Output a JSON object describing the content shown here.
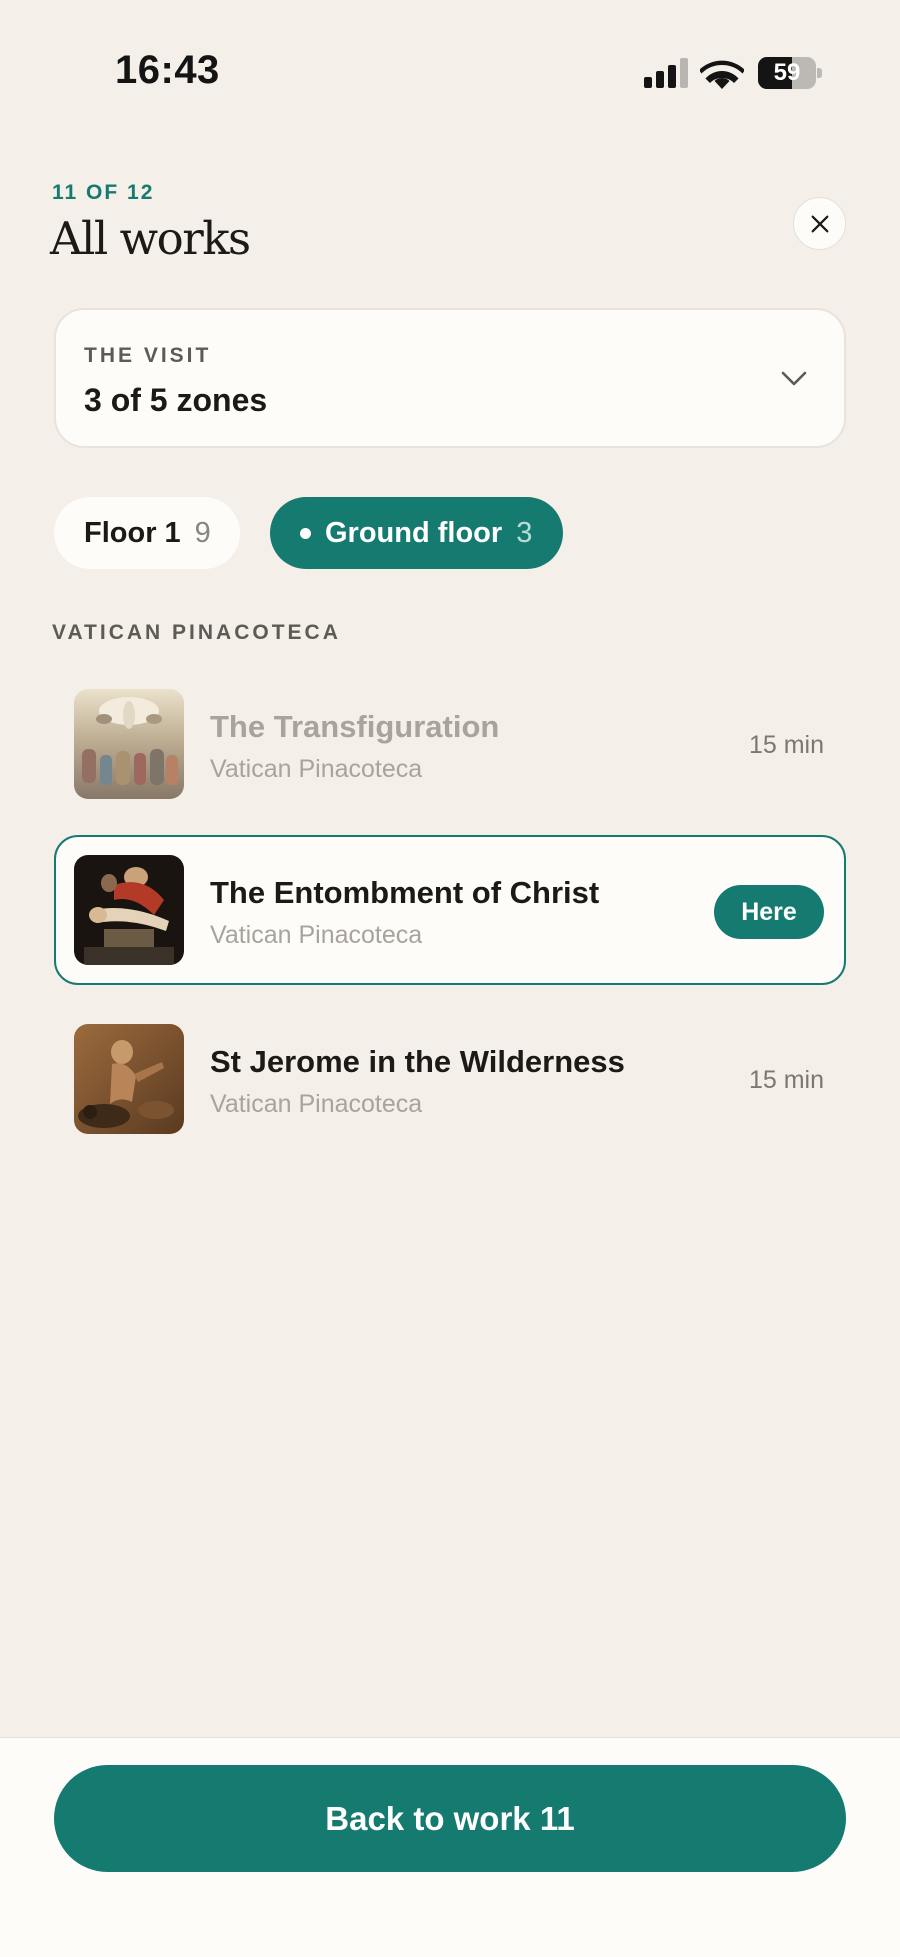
{
  "status_bar": {
    "time": "16:43",
    "battery_level": "59",
    "battery_fraction": 0.59,
    "signal_icon": "cellular-signal-icon",
    "wifi_icon": "wifi-icon"
  },
  "header": {
    "counter": "11 OF 12",
    "title": "All works",
    "close_icon": "close-icon"
  },
  "visit": {
    "label": "THE VISIT",
    "value": "3 of 5 zones",
    "chevron_icon": "chevron-down-icon"
  },
  "floors": [
    {
      "label": "Floor 1",
      "count": "9",
      "selected": false
    },
    {
      "label": "Ground floor",
      "count": "3",
      "selected": true
    }
  ],
  "section": {
    "title": "VATICAN PINACOTECA"
  },
  "works": [
    {
      "title": "The Transfiguration",
      "location": "Vatican Pinacoteca",
      "meta": "15 min",
      "state": "visited"
    },
    {
      "title": "The Entombment of Christ",
      "location": "Vatican Pinacoteca",
      "badge": "Here",
      "state": "current"
    },
    {
      "title": "St Jerome in the Wilderness",
      "location": "Vatican Pinacoteca",
      "meta": "15 min",
      "state": "upcoming"
    }
  ],
  "cta": {
    "label": "Back to work 11"
  },
  "colors": {
    "accent": "#157a70",
    "background": "#f4efe9",
    "card": "#fdfcf9"
  }
}
